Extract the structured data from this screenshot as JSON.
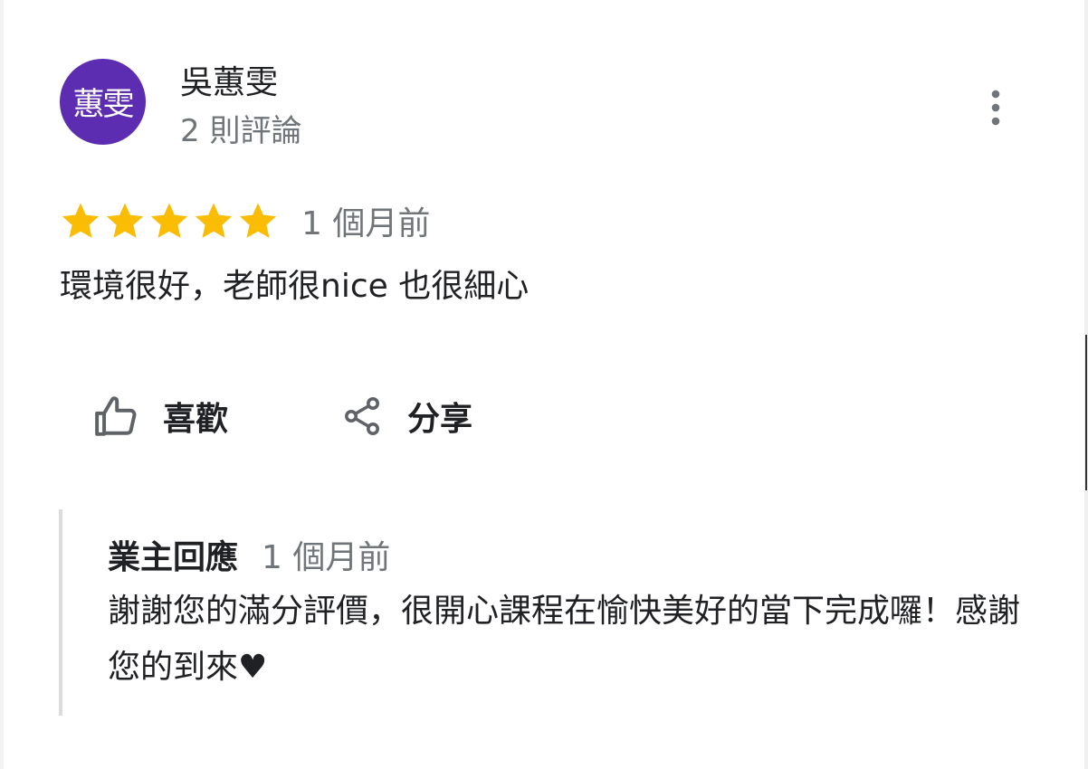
{
  "reviewer": {
    "avatar_text": "蕙雯",
    "avatar_color": "#5c2db0",
    "name": "吳蕙雯",
    "review_count": "2 則評論"
  },
  "menu": {
    "icon": "more-vert-icon"
  },
  "rating": {
    "stars": 5,
    "max_stars": 5,
    "star_color": "#fbbc04",
    "time": "1 個月前"
  },
  "review": {
    "text": "環境很好，老師很nice 也很細心"
  },
  "actions": {
    "like_label": "喜歡",
    "like_icon": "thumbs-up-icon",
    "share_label": "分享",
    "share_icon": "share-icon"
  },
  "owner_reply": {
    "label": "業主回應",
    "time": "1 個月前",
    "text": "謝謝您的滿分評價，很開心課程在愉快美好的當下完成囉！感謝您的到來♥"
  }
}
